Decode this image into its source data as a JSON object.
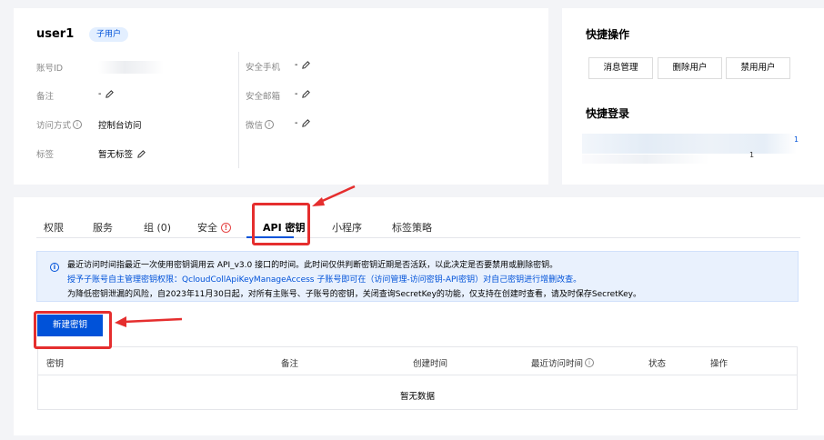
{
  "user": {
    "name": "user1",
    "badge": "子用户",
    "fields_left": [
      {
        "label": "账号ID",
        "value": ""
      },
      {
        "label": "备注",
        "value": "-"
      },
      {
        "label": "访问方式",
        "value": "控制台访问"
      },
      {
        "label": "标签",
        "value": "暂无标签"
      }
    ],
    "fields_right": [
      {
        "label": "安全手机",
        "value": "-"
      },
      {
        "label": "安全邮箱",
        "value": "-"
      },
      {
        "label": "微信",
        "value": "-"
      }
    ]
  },
  "quick_actions": {
    "title": "快捷操作",
    "buttons": [
      "消息管理",
      "删除用户",
      "禁用用户"
    ],
    "login_title": "快捷登录",
    "login_fragment_1": "1",
    "login_fragment_2": "1"
  },
  "tabs": [
    {
      "label": "权限"
    },
    {
      "label": "服务"
    },
    {
      "label": "组 (0)"
    },
    {
      "label": "安全"
    },
    {
      "label": "API 密钥"
    },
    {
      "label": "小程序"
    },
    {
      "label": "标签策略"
    }
  ],
  "active_tab": "API 密钥",
  "notice": {
    "line1": "最近访问时间指最近一次使用密钥调用云 API_v3.0 接口的时间。此时间仅供判断密钥近期是否活跃，以此决定是否要禁用或删除密钥。",
    "line2": "授予子账号自主管理密钥权限：QcloudCollApiKeyManageAccess 子账号即可在（访问管理-访问密钥-API密钥）对自己密钥进行增删改查。",
    "line3": "为降低密钥泄漏的风险，自2023年11月30日起，对所有主账号、子账号的密钥，关闭查询SecretKey的功能，仅支持在创建时查看，请及时保存SecretKey。"
  },
  "new_key_button": "新建密钥",
  "table": {
    "columns": [
      "密钥",
      "备注",
      "创建时间",
      "最近访问时间",
      "状态",
      "操作"
    ],
    "empty_text": "暂无数据"
  },
  "colors": {
    "primary": "#0052d9",
    "annotation_red": "#e52e2e",
    "warning": "#e54545"
  }
}
